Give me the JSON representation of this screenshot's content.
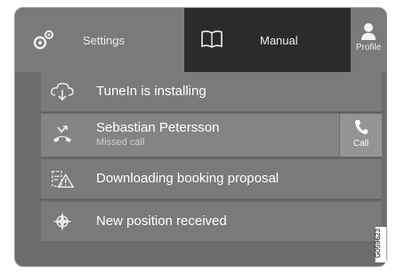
{
  "header": {
    "settings_label": "Settings",
    "manual_label": "Manual",
    "profile_label": "Profile"
  },
  "notifications": [
    {
      "title": "TuneIn is installing",
      "icon": "cloud-download-icon"
    },
    {
      "title": "Sebastian Petersson",
      "subtitle": "Missed call",
      "icon": "missed-call-icon",
      "action_label": "Call",
      "action_icon": "phone-icon"
    },
    {
      "title": "Downloading booking proposal",
      "icon": "service-warning-icon"
    },
    {
      "title": "New position received",
      "icon": "compass-icon"
    }
  ],
  "image_code": "G059623",
  "colors": {
    "background": "#6c6c6c",
    "active_tab": "#2b2b2b",
    "card": "#7a7a7a"
  }
}
